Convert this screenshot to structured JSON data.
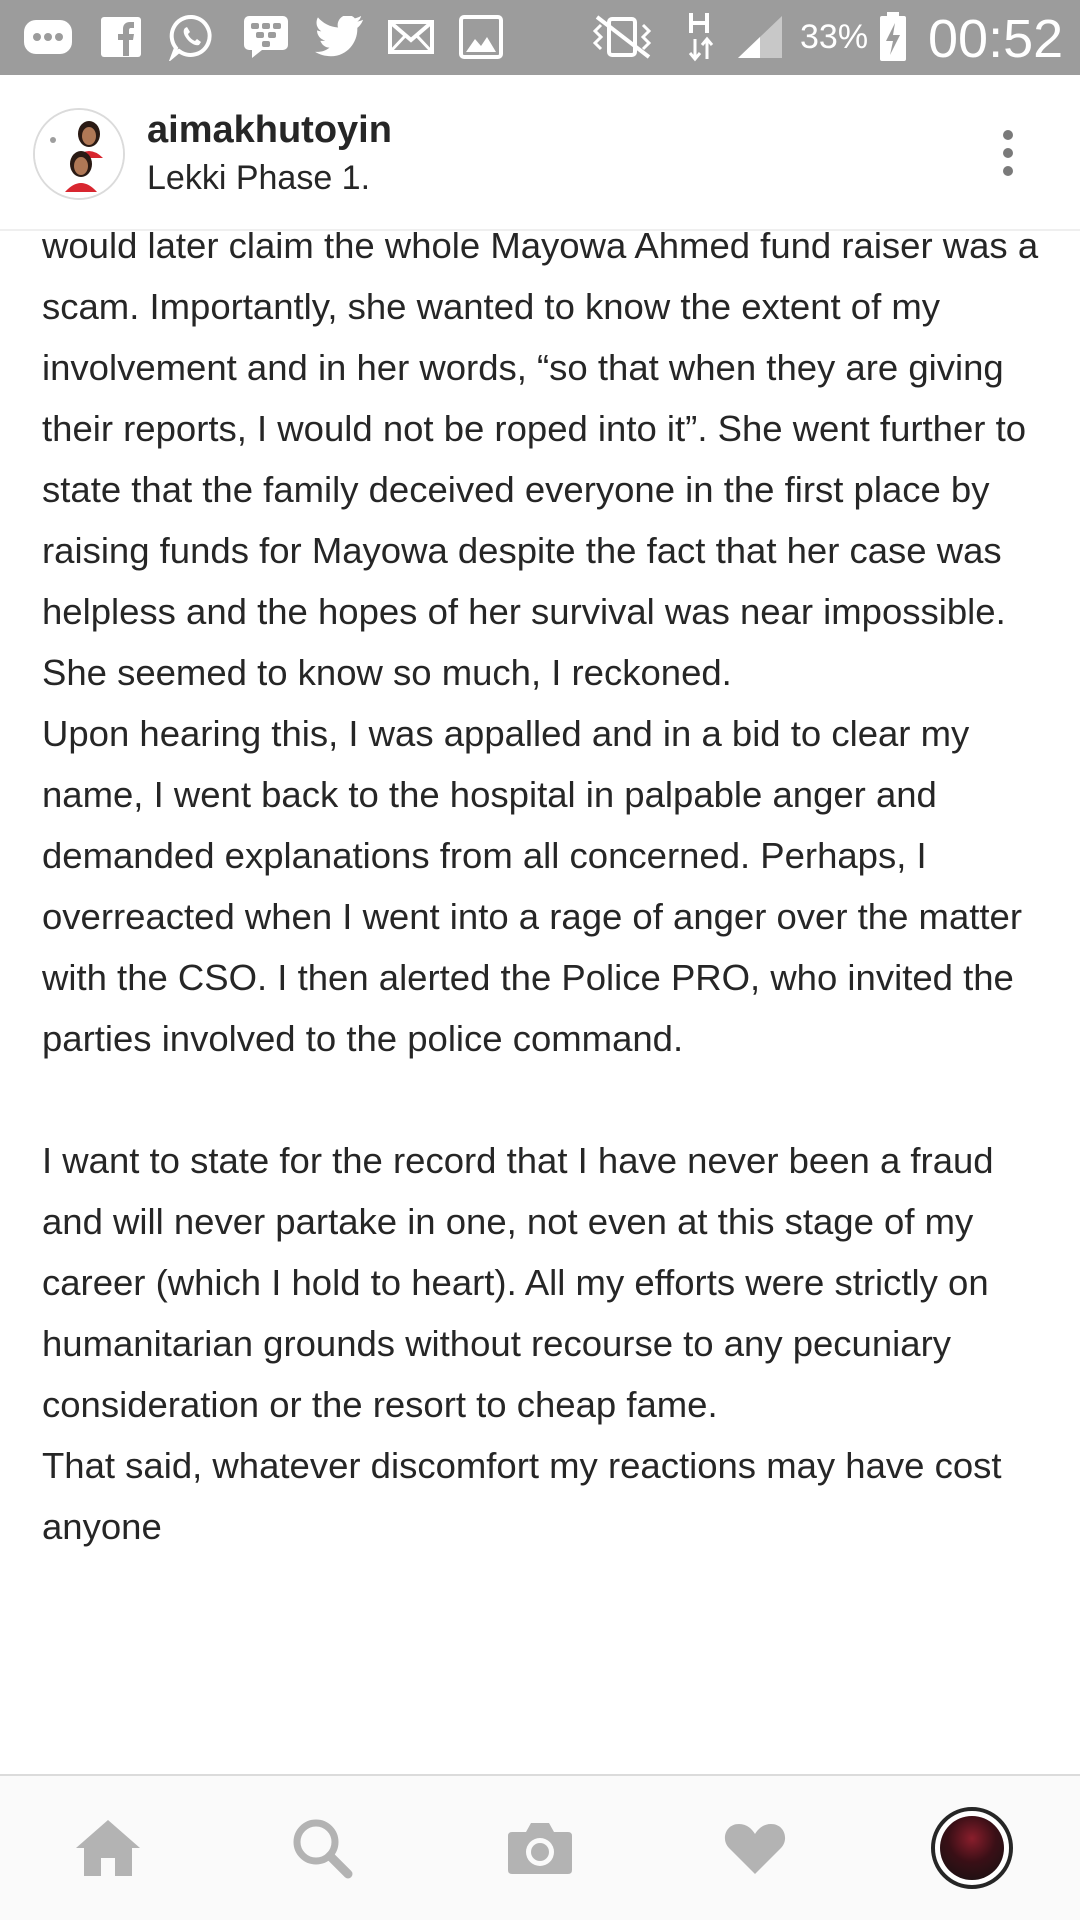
{
  "status_bar": {
    "icons": [
      "chat-icon",
      "facebook-icon",
      "whatsapp-icon",
      "bbm-icon",
      "twitter-icon",
      "mail-icon",
      "gallery-icon",
      "vibrate-mute-icon",
      "network-h-icon",
      "signal-icon",
      "battery-charging-icon"
    ],
    "battery_percent": "33%",
    "clock": "00:52"
  },
  "post": {
    "username": "aimakhutoyin",
    "location": "Lekki Phase 1.",
    "caption": "would later claim the whole Mayowa Ahmed fund raiser was a scam. Importantly, she wanted to know the extent of my involvement and in her words, “so that when they are giving their reports, I would not be roped into it”. She went further to state that the family deceived everyone in the first place by raising funds for Mayowa despite the fact that her case was helpless and the hopes of her survival was near impossible. She seemed to know so much, I reckoned.\nUpon hearing this, I was appalled and in a bid to clear my name, I went back to the hospital in palpable anger and demanded explanations from all concerned. Perhaps, I overreacted when I went into a rage of anger over the matter with the CSO. I then alerted the Police PRO, who invited the parties involved to the police command.\n\nI want to state for the record that I have never been a fraud and will never partake in one, not even at this stage of my career (which I hold to heart). All my efforts were strictly on humanitarian grounds without recourse to any pecuniary consideration or the resort to cheap fame.\nThat said, whatever discomfort my reactions may have cost anyone"
  },
  "bottom_nav": {
    "items": [
      "home-icon",
      "search-icon",
      "camera-icon",
      "heart-icon",
      "profile-avatar"
    ]
  },
  "colors": {
    "status_bar": "#9c9c9c",
    "text": "#262626",
    "nav_icon": "#b3b3b3",
    "nav_background": "#fafafa"
  }
}
